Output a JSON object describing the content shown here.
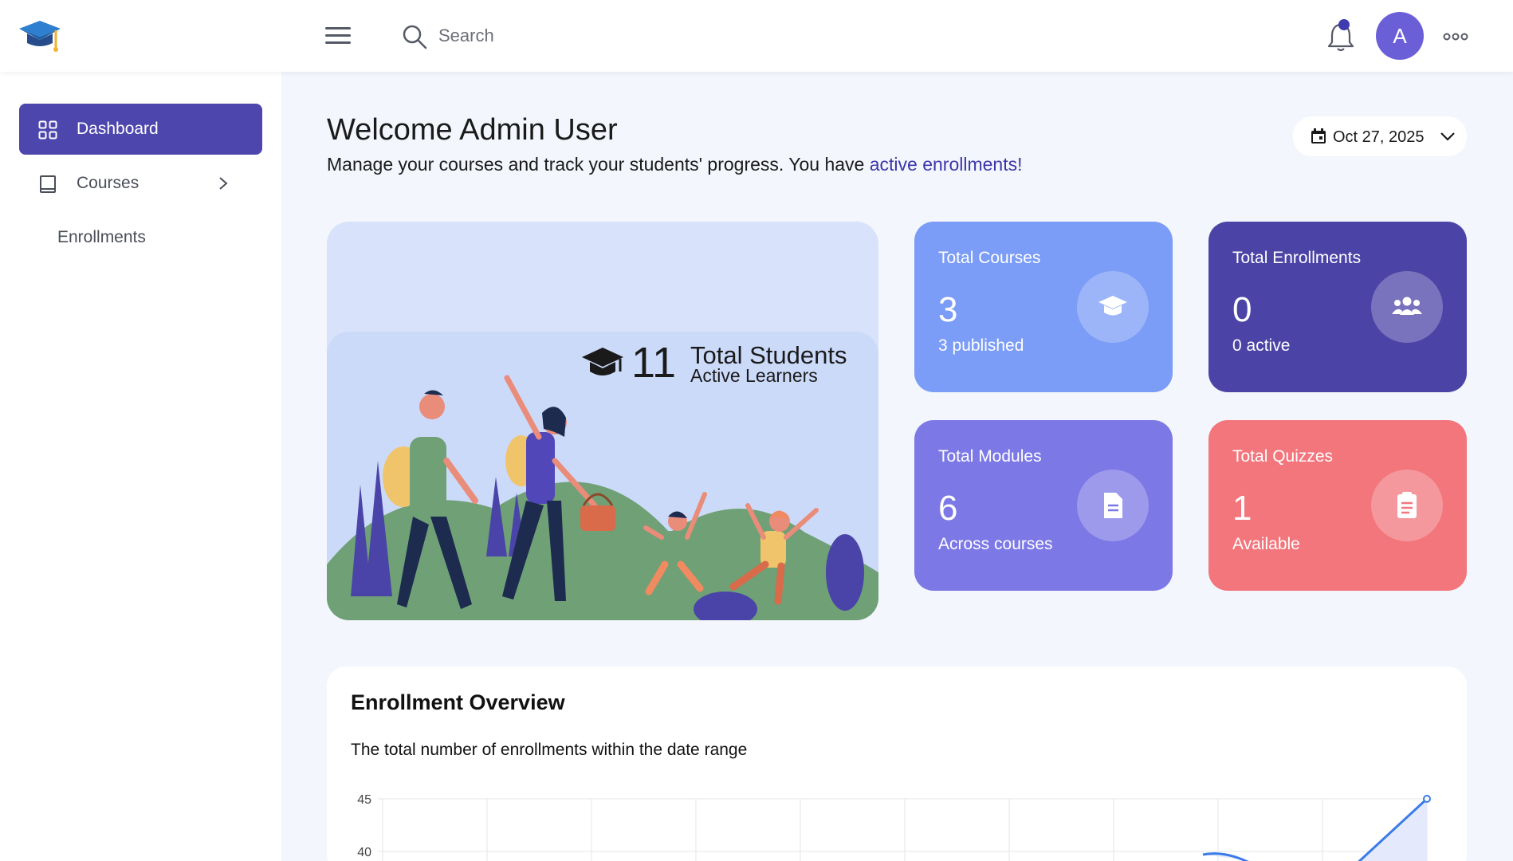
{
  "header": {
    "search_placeholder": "Search",
    "avatar_initial": "A",
    "colors": {
      "accent": "#4d46ad",
      "avatar": "#6b5fd8",
      "notification_dot": "#3e3ab0"
    }
  },
  "sidebar": {
    "items": [
      {
        "label": "Dashboard",
        "icon": "grid-icon",
        "active": true
      },
      {
        "label": "Courses",
        "icon": "book-icon",
        "active": false,
        "has_children": true
      },
      {
        "label": "Enrollments",
        "icon": "",
        "active": false,
        "submenu": true
      }
    ]
  },
  "welcome": {
    "title": "Welcome Admin User",
    "subtitle_prefix": "Manage your courses and track your students' progress. You have ",
    "subtitle_link": "active enrollments!"
  },
  "date_picker": {
    "value": "Oct 27, 2025"
  },
  "hero": {
    "count": "11",
    "label": "Total Students",
    "sublabel": "Active Learners"
  },
  "stats": [
    {
      "title": "Total Courses",
      "value": "3",
      "sub": "3 published",
      "icon": "graduation-cap-icon",
      "color": "#7b9cf7"
    },
    {
      "title": "Total Enrollments",
      "value": "0",
      "sub": "0 active",
      "icon": "users-icon",
      "color": "#4b44a6"
    },
    {
      "title": "Total Modules",
      "value": "6",
      "sub": "Across courses",
      "icon": "document-icon",
      "color": "#7c78e6"
    },
    {
      "title": "Total Quizzes",
      "value": "1",
      "sub": "Available",
      "icon": "clipboard-icon",
      "color": "#f2767c"
    }
  ],
  "enrollment_chart": {
    "title": "Enrollment Overview",
    "description": "The total number of enrollments within the date range",
    "y_ticks": [
      "45",
      "40"
    ]
  },
  "chart_data": {
    "type": "area",
    "title": "Enrollment Overview",
    "ylim": [
      40,
      45
    ],
    "grid": true,
    "x_gridlines": 11,
    "series": [
      {
        "values_visible_tail": [
          40,
          45
        ]
      }
    ]
  }
}
